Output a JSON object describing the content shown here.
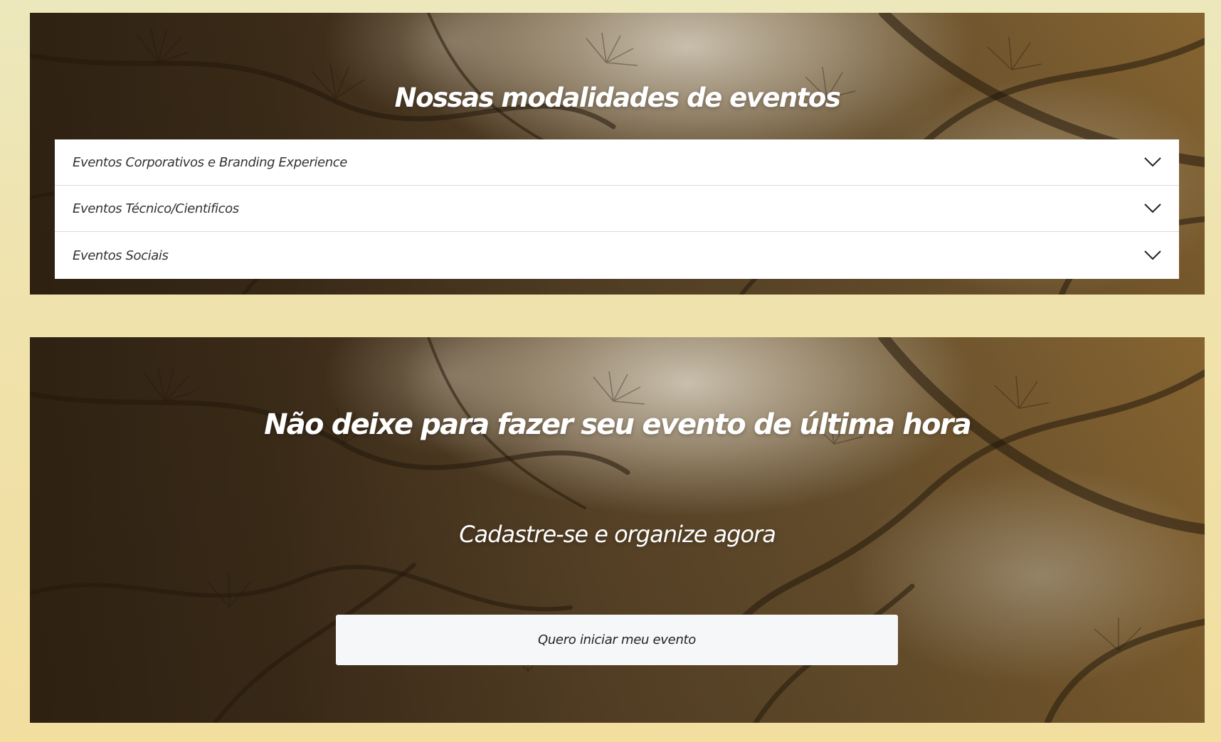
{
  "modalities": {
    "title": "Nossas modalidades de eventos",
    "items": [
      {
        "label": "Eventos Corporativos e Branding Experience",
        "icon": "chevron-down-icon"
      },
      {
        "label": "Eventos Técnico/Cientificos",
        "icon": "chevron-down-icon"
      },
      {
        "label": "Eventos Sociais",
        "icon": "chevron-down-icon"
      }
    ]
  },
  "cta_section": {
    "title": "Não deixe para fazer seu evento de última hora",
    "subtitle": "Cadastre-se e organize agora",
    "button_label": "Quero iniciar meu evento"
  },
  "colors": {
    "page_background": "#F0E2AB",
    "hero_dark": "#3C2C19",
    "hero_warm": "#8B6833",
    "accordion_background": "#FFFFFF",
    "button_background": "#F6F7F9"
  }
}
